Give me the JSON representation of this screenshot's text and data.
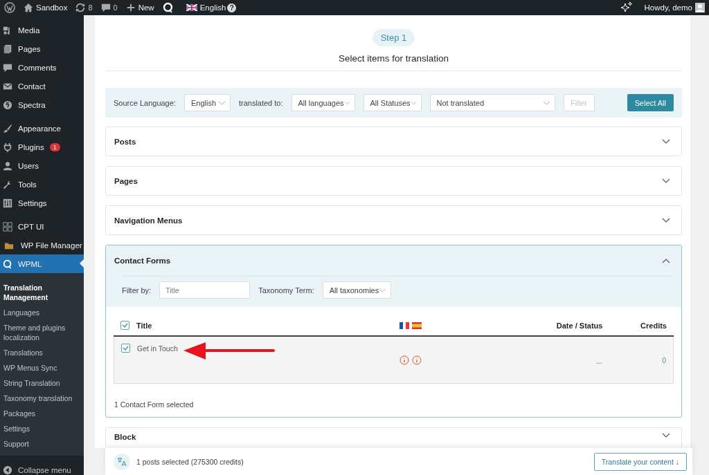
{
  "admin_bar": {
    "site": "Sandbox",
    "updates": "8",
    "comments": "0",
    "new": "New",
    "language": "English",
    "help": "?",
    "greeting": "Howdy, demo"
  },
  "sidebar": {
    "groups": [
      [
        {
          "label": "Media",
          "selected": false
        },
        {
          "label": "Pages",
          "selected": false
        },
        {
          "label": "Comments",
          "selected": false
        },
        {
          "label": "Contact",
          "selected": false
        },
        {
          "label": "Spectra",
          "selected": false
        }
      ],
      [
        {
          "label": "Appearance",
          "selected": false
        },
        {
          "label": "Plugins",
          "selected": false,
          "badge": "1"
        },
        {
          "label": "Users",
          "selected": false
        },
        {
          "label": "Tools",
          "selected": false
        },
        {
          "label": "Settings",
          "selected": false
        }
      ],
      [
        {
          "label": "CPT UI",
          "selected": false
        },
        {
          "label": "WP File Manager",
          "selected": false
        },
        {
          "label": "WPML",
          "selected": true
        }
      ]
    ],
    "submenu": [
      {
        "label": "Translation Management",
        "selected": true
      },
      {
        "label": "Languages",
        "selected": false
      },
      {
        "label": "Theme and plugins localization",
        "selected": false
      },
      {
        "label": "Translations",
        "selected": false
      },
      {
        "label": "WP Menus Sync",
        "selected": false
      },
      {
        "label": "String Translation",
        "selected": false
      },
      {
        "label": "Taxonomy translation",
        "selected": false
      },
      {
        "label": "Packages",
        "selected": false
      },
      {
        "label": "Settings",
        "selected": false
      },
      {
        "label": "Support",
        "selected": false
      }
    ],
    "collapse": "Collapse menu"
  },
  "step": {
    "badge": "Step 1",
    "title": "Select items for translation"
  },
  "filter_bar": {
    "source_label": "Source Language:",
    "source_value": "English",
    "translated_label": "translated to:",
    "languages": "All languages",
    "statuses": "All Statuses",
    "translation_status": "Not translated",
    "filter_button": {
      "label": "Filter",
      "disabled": true
    },
    "select_all": "Select All"
  },
  "sections": [
    {
      "title": "Posts",
      "expanded": false
    },
    {
      "title": "Pages",
      "expanded": false
    },
    {
      "title": "Navigation Menus",
      "expanded": false
    },
    {
      "title": "Contact Forms",
      "expanded": true,
      "filter_label": "Filter by:",
      "filter_placeholder": "Title",
      "taxonomy_label": "Taxonomy Term:",
      "taxonomy_value": "All taxonomies",
      "select_all_checked": true,
      "columns": [
        "Title",
        "Date / Status",
        "Credits"
      ],
      "rows": [
        {
          "title": "Get in Touch",
          "checked": true,
          "date_status": "...",
          "credits": "0"
        }
      ],
      "summary": "1 Contact Form selected"
    },
    {
      "title": "Block",
      "expanded": false
    }
  ],
  "footer_bar": {
    "summary": "1 posts selected (275300 credits)",
    "button": "Translate your content ↓"
  }
}
